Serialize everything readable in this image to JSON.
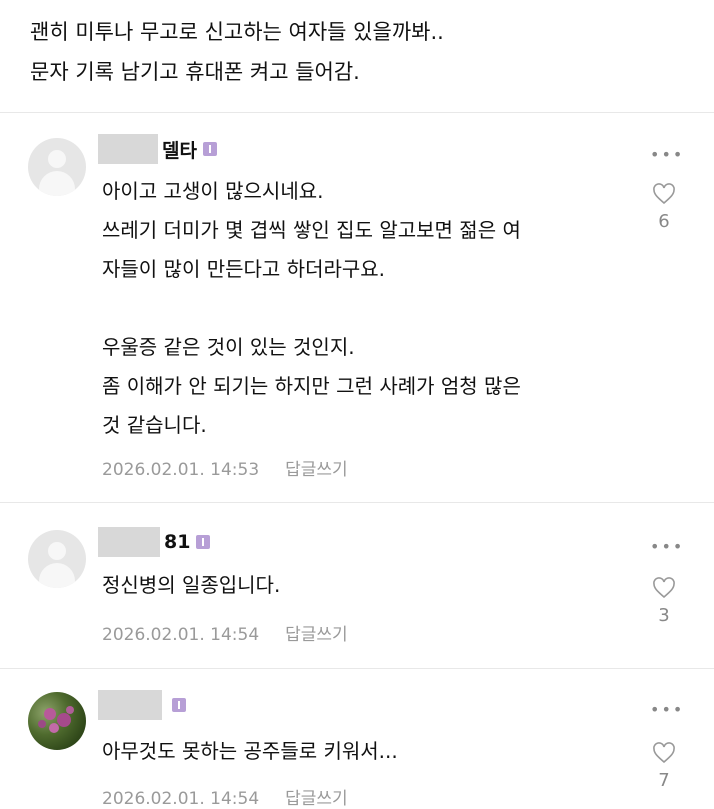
{
  "intro": {
    "line1": "괜히 미투나 무고로 신고하는 여자들 있을까봐..",
    "line2": "문자 기록 남기고 휴대폰 켜고 들어감."
  },
  "comments": [
    {
      "nickname": "델타",
      "text": "아이고 고생이 많으시네요.\n쓰레기 더미가 몇 겹씩 쌓인 집도 알고보면 젊은 여\n자들이 많이 만든다고 하더라구요.\n\n우울증 같은 것이 있는 것인지.\n좀 이해가 안 되기는 하지만 그런 사례가 엄청 많은\n것 같습니다.",
      "date": "2026.02.01. 14:53",
      "reply": "답글쓰기",
      "likes": "6"
    },
    {
      "nickname": "81",
      "text": "정신병의 일종입니다.",
      "date": "2026.02.01. 14:54",
      "reply": "답글쓰기",
      "likes": "3"
    },
    {
      "nickname": "",
      "text": "아무것도 못하는 공주들로 키워서...",
      "date": "2026.02.01. 14:54",
      "reply": "답글쓰기",
      "likes": "7"
    }
  ],
  "icons": {
    "more": "more-options-icon",
    "like": "heart-icon",
    "badge": "level-badge-icon"
  },
  "colors": {
    "badge": "#b79fd6",
    "meta": "#9a9a9a"
  }
}
